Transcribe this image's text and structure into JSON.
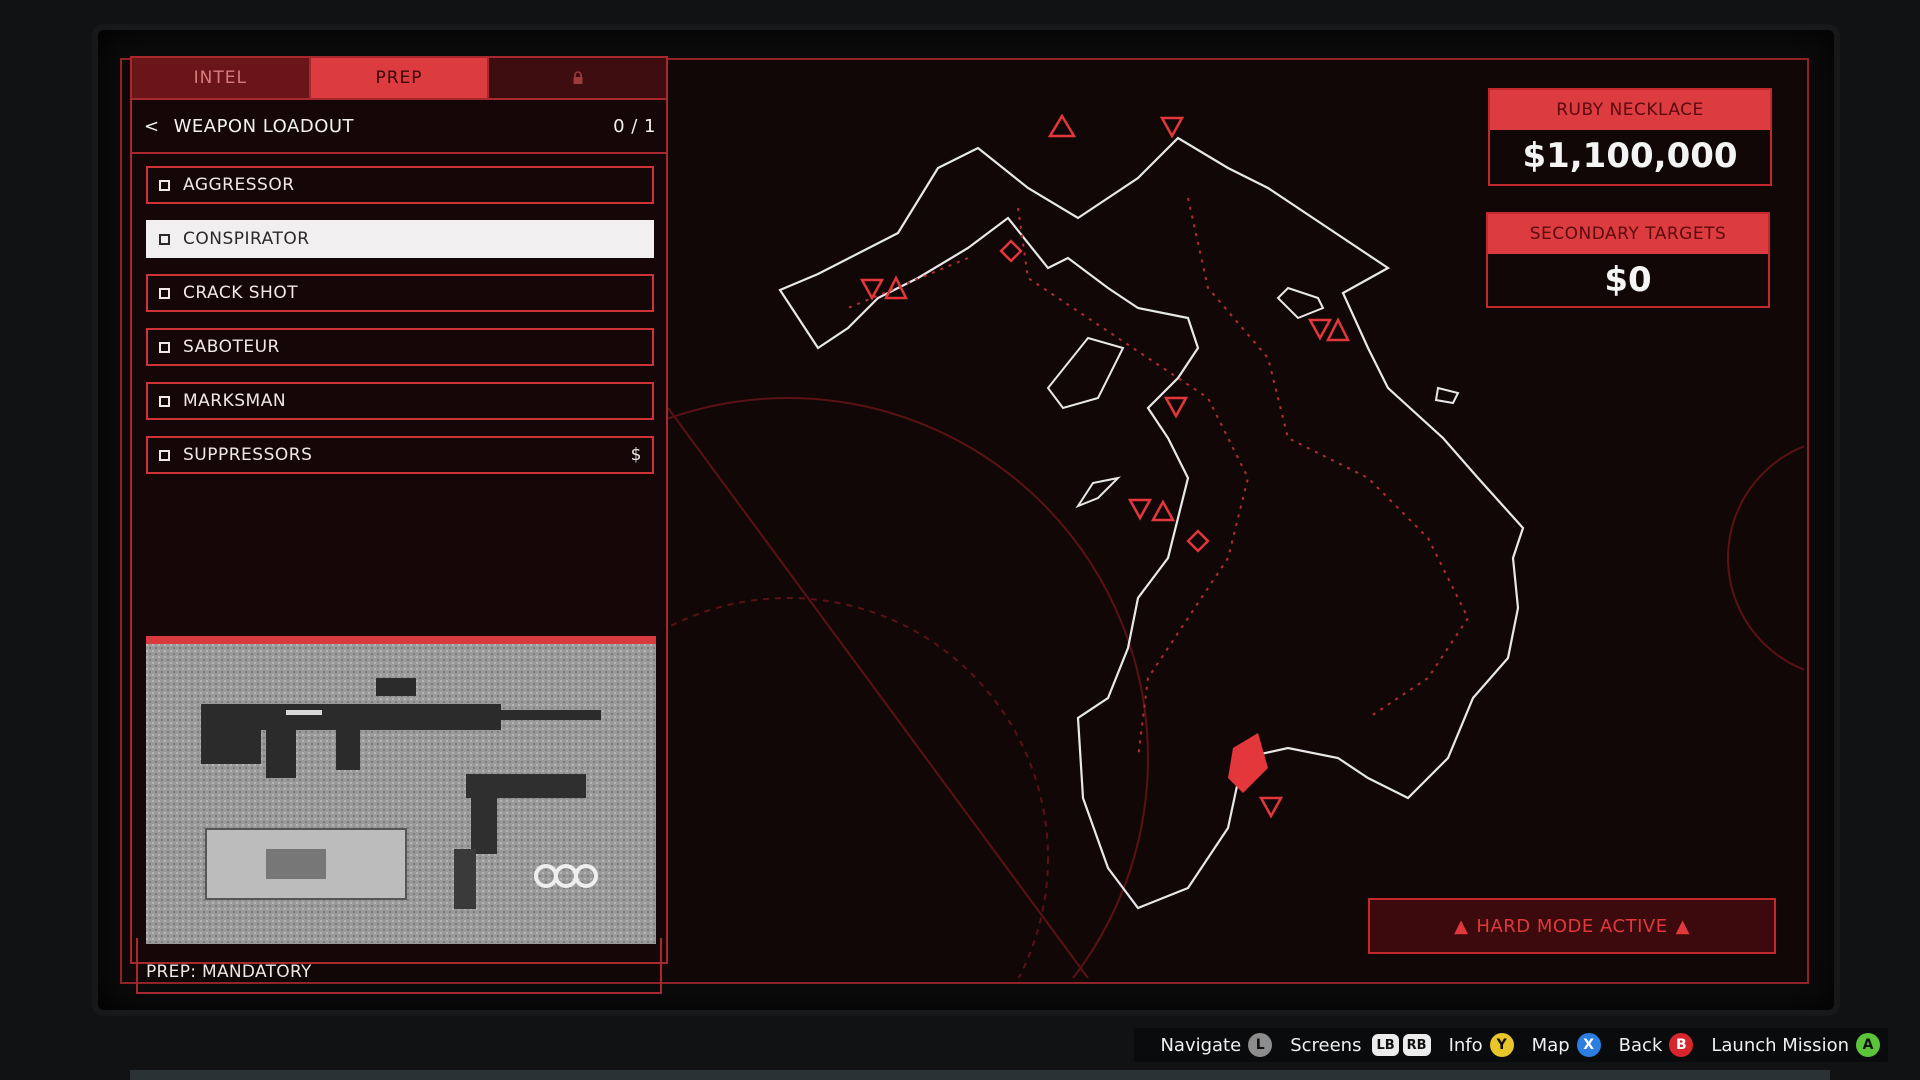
{
  "tabs": [
    {
      "label": "INTEL",
      "state": "normal"
    },
    {
      "label": "PREP",
      "state": "active"
    },
    {
      "label": "",
      "state": "locked",
      "icon": "lock-icon"
    }
  ],
  "loadout": {
    "back": "<",
    "title": "WEAPON LOADOUT",
    "count": "0 / 1"
  },
  "options": [
    {
      "label": "AGGRESSOR",
      "suffix": ""
    },
    {
      "label": "CONSPIRATOR",
      "suffix": ""
    },
    {
      "label": "CRACK SHOT",
      "suffix": ""
    },
    {
      "label": "SABOTEUR",
      "suffix": ""
    },
    {
      "label": "MARKSMAN",
      "suffix": ""
    },
    {
      "label": "SUPPRESSORS",
      "suffix": "$"
    }
  ],
  "selected_option": "CONSPIRATOR",
  "prep_status": "PREP: MANDATORY",
  "targets": {
    "primary": {
      "label": "RUBY NECKLACE",
      "value": "$1,100,000"
    },
    "secondary": {
      "label": "SECONDARY TARGETS",
      "value": "$0"
    }
  },
  "hard_mode": "HARD MODE ACTIVE",
  "hints": [
    {
      "label": "Navigate",
      "keys": [
        "L"
      ],
      "color": "#8d8d8d"
    },
    {
      "label": "Screens",
      "keys": [
        "LB",
        "RB"
      ],
      "color": "#ececec"
    },
    {
      "label": "Info",
      "keys": [
        "Y"
      ],
      "color": "#e8c62a"
    },
    {
      "label": "Map",
      "keys": [
        "X"
      ],
      "color": "#2b7fe0"
    },
    {
      "label": "Back",
      "keys": [
        "B"
      ],
      "color": "#d6262b"
    },
    {
      "label": "Launch Mission",
      "keys": [
        "A"
      ],
      "color": "#5cc43a"
    }
  ],
  "colors": {
    "accent": "#dc3b40",
    "panel": "#120707",
    "island_outline": "#e8e8e8",
    "target_zone": "#e3373b"
  }
}
